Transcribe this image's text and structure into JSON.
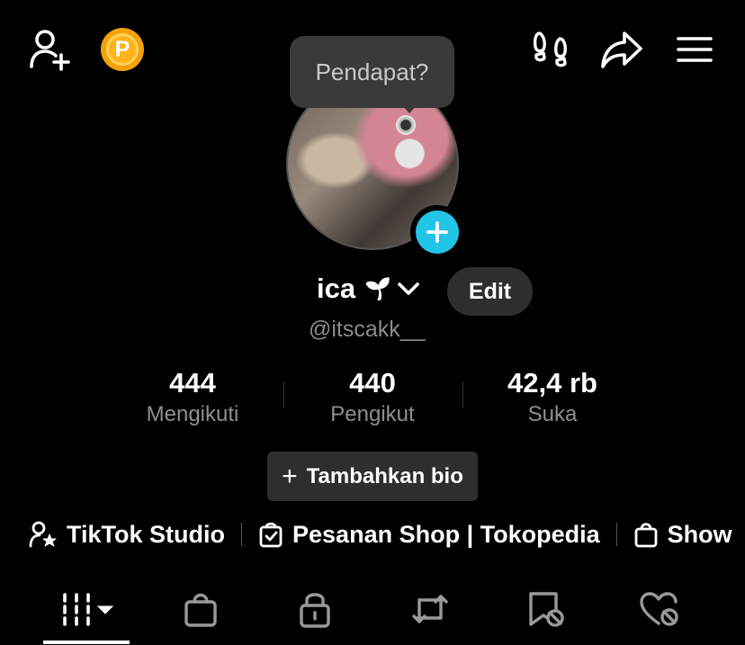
{
  "tooltip": {
    "text": "Pendapat?"
  },
  "topbar": {
    "coin_label": "P",
    "icons": [
      "add-friend-icon",
      "coin-icon",
      "footprints-icon",
      "share-icon",
      "menu-icon"
    ]
  },
  "profile": {
    "name": "ica",
    "emoji": "🌱",
    "handle": "@itscakk__",
    "edit_label": "Edit"
  },
  "stats": [
    {
      "value": "444",
      "label": "Mengikuti"
    },
    {
      "value": "440",
      "label": "Pengikut"
    },
    {
      "value": "42,4 rb",
      "label": "Suka"
    }
  ],
  "bio_button": {
    "plus": "+",
    "label": "Tambahkan bio"
  },
  "links": [
    {
      "label": "TikTok Studio",
      "icon": "person-star-icon"
    },
    {
      "label": "Pesanan Shop | Tokopedia",
      "icon": "order-bag-icon"
    },
    {
      "label": "Show",
      "icon": "shopping-bag-icon"
    }
  ],
  "tabs": [
    {
      "name": "videos",
      "icon": "grid-icon",
      "active": true
    },
    {
      "name": "shop",
      "icon": "bag-icon"
    },
    {
      "name": "private",
      "icon": "lock-icon"
    },
    {
      "name": "reposts",
      "icon": "repost-icon"
    },
    {
      "name": "favorites",
      "icon": "bookmark-icon"
    },
    {
      "name": "liked",
      "icon": "heart-hidden-icon"
    }
  ],
  "colors": {
    "background": "#000000",
    "coin": "#F5A10C",
    "add_button": "#22C4E8",
    "chip": "#2e2e2e"
  }
}
